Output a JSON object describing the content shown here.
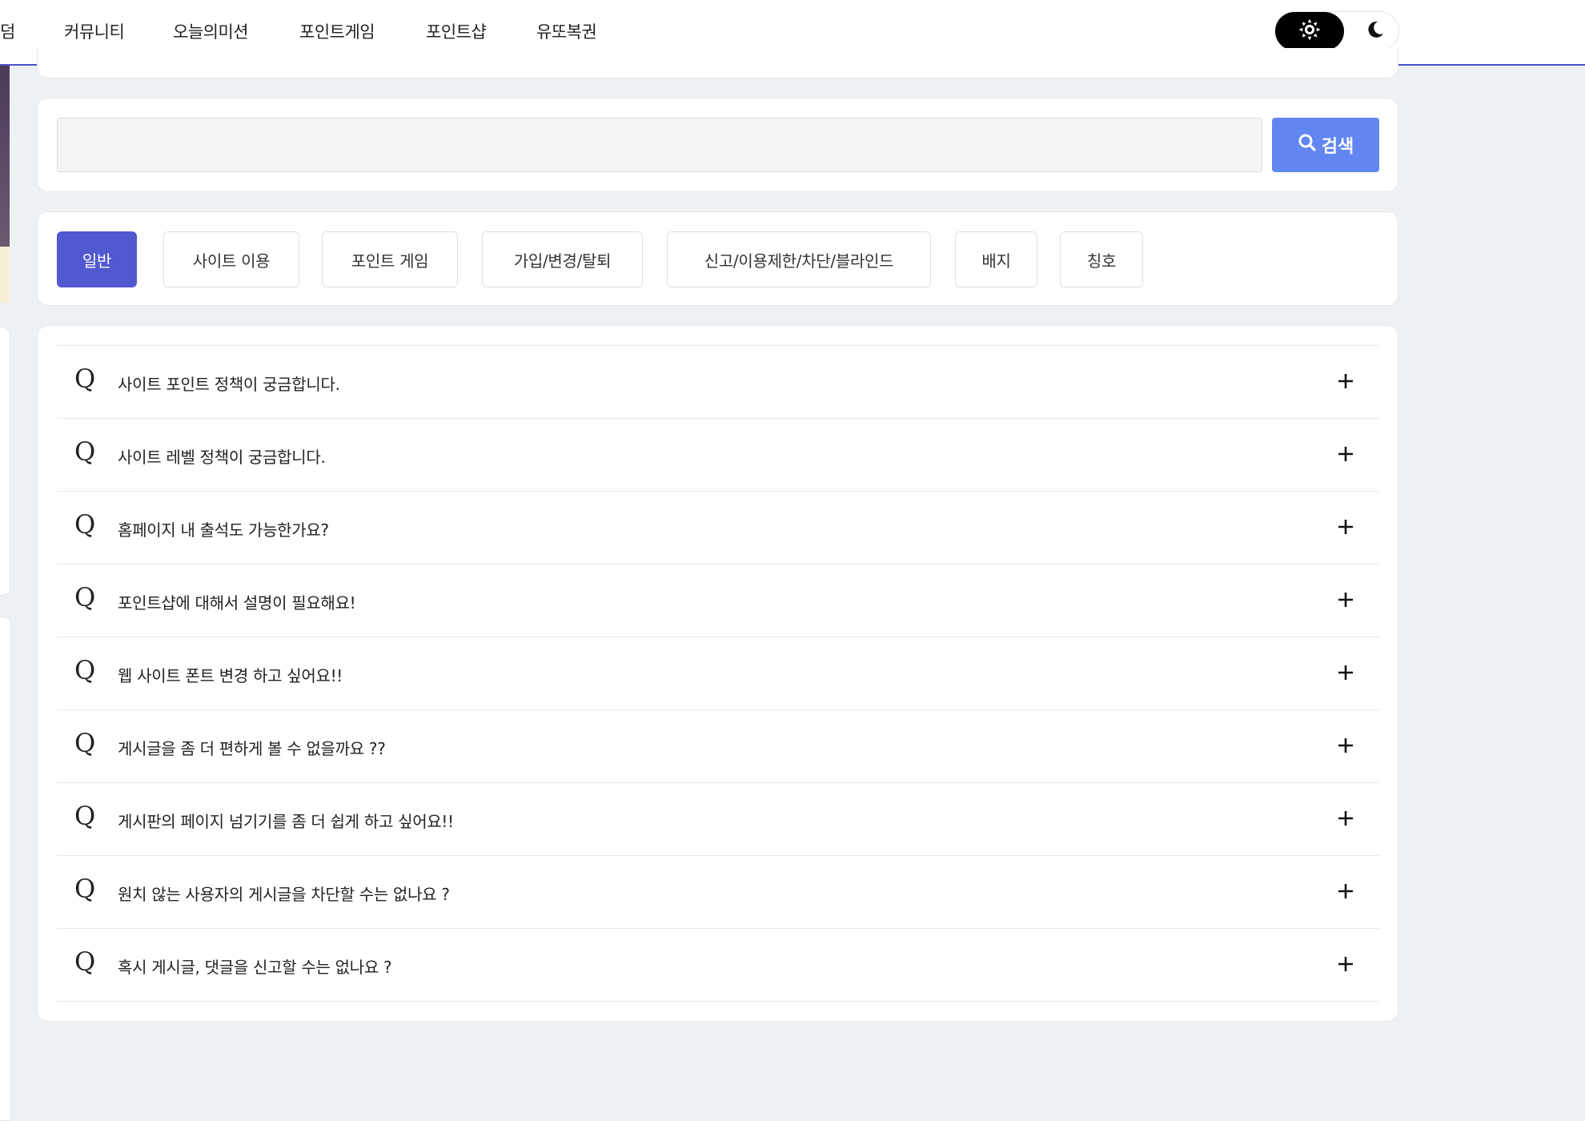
{
  "nav": {
    "items": [
      {
        "label": "덤"
      },
      {
        "label": "커뮤니티"
      },
      {
        "label": "오늘의미션"
      },
      {
        "label": "포인트게임"
      },
      {
        "label": "포인트샵"
      },
      {
        "label": "유또복권"
      }
    ],
    "theme": {
      "light_icon": "sun-icon",
      "dark_icon": "moon-icon",
      "active": "light"
    }
  },
  "search": {
    "value": "",
    "placeholder": "",
    "button_label": "검색",
    "button_icon": "search-icon",
    "button_color": "#6186f2"
  },
  "tabs": [
    {
      "label": "일반",
      "active": true
    },
    {
      "label": "사이트 이용",
      "active": false
    },
    {
      "label": "포인트 게임",
      "active": false
    },
    {
      "label": "가입/변경/탈퇴",
      "active": false
    },
    {
      "label": "신고/이용제한/차단/블라인드",
      "active": false
    },
    {
      "label": "배지",
      "active": false
    },
    {
      "label": "칭호",
      "active": false
    }
  ],
  "accent_color": "#5159d0",
  "faq": {
    "marker": "Q",
    "expand_icon": "plus-icon",
    "items": [
      {
        "question": "사이트 포인트 정책이 궁금합니다."
      },
      {
        "question": "사이트 레벨 정책이 궁금합니다."
      },
      {
        "question": "홈페이지 내 출석도 가능한가요?"
      },
      {
        "question": "포인트샵에 대해서 설명이 필요해요!"
      },
      {
        "question": "웹 사이트 폰트 변경 하고 싶어요!!"
      },
      {
        "question": "게시글을 좀 더 편하게 볼 수 없을까요 ??"
      },
      {
        "question": "게시판의 페이지 넘기기를 좀 더 쉽게 하고 싶어요!!"
      },
      {
        "question": "원치 않는 사용자의 게시글을 차단할 수는 없나요 ?"
      },
      {
        "question": "혹시 게시글, 댓글을 신고할 수는 없나요 ?"
      }
    ]
  }
}
